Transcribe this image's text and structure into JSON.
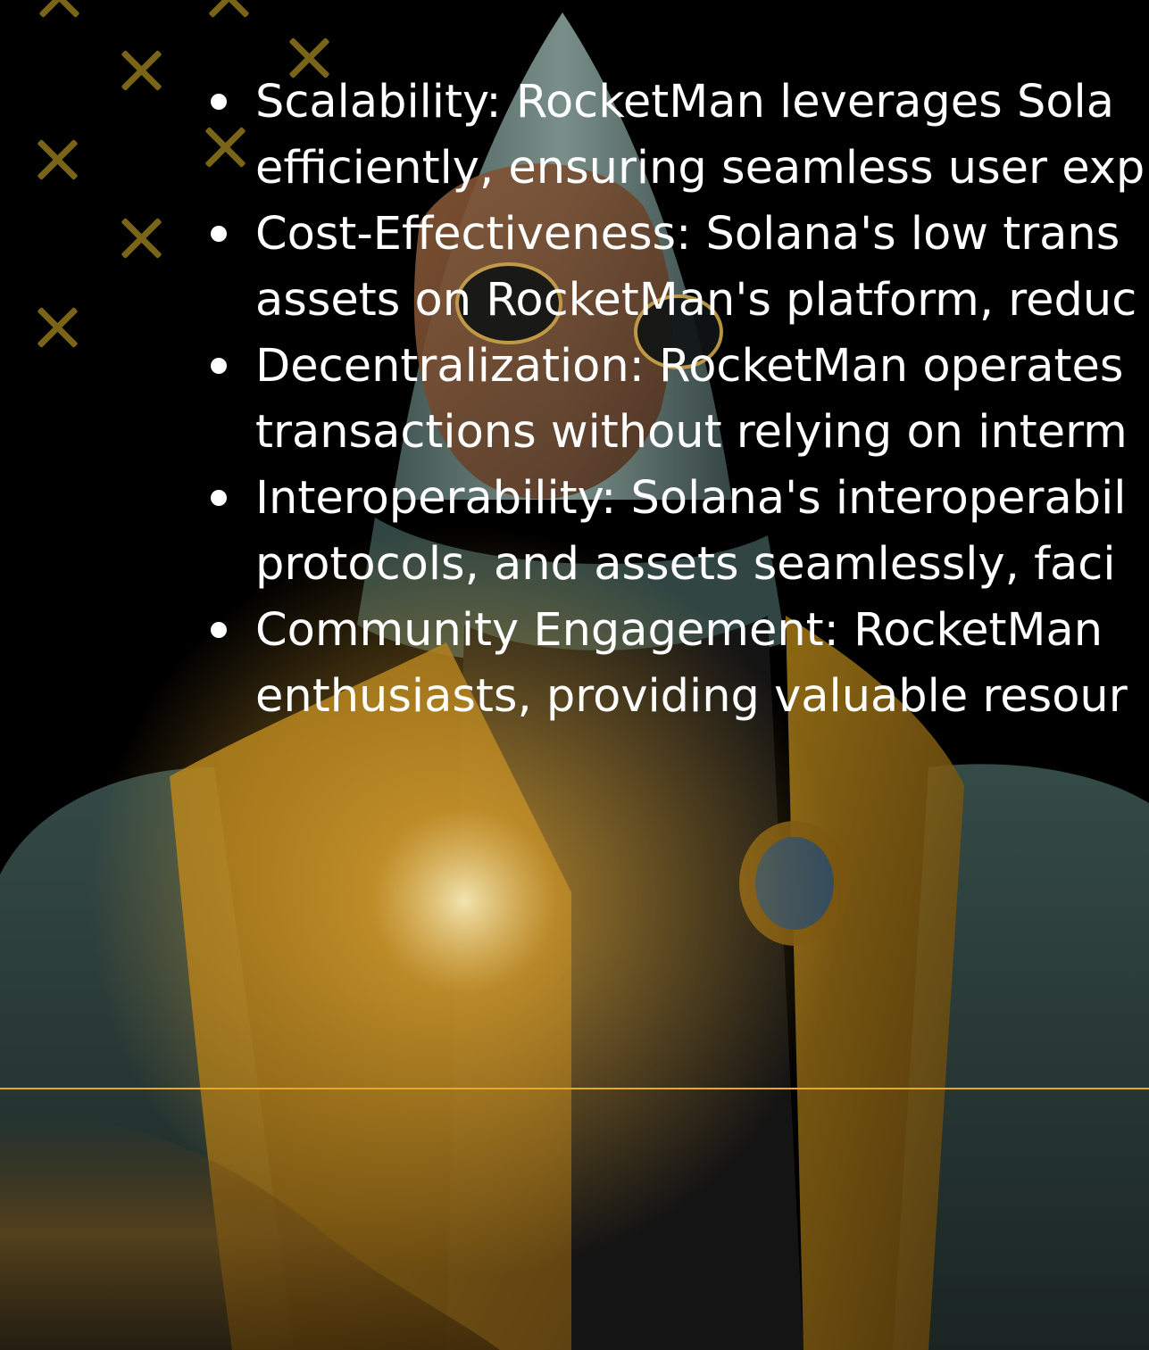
{
  "colors": {
    "background": "#000000",
    "accent": "#e8a91e",
    "decor_x": "#7a6418",
    "text": "#ffffff"
  },
  "hero": {
    "icon": "rocketman-illustration"
  },
  "features": [
    {
      "line1": "Scalability: RocketMan leverages Sola",
      "line2": "efficiently, ensuring seamless user exp"
    },
    {
      "line1": "Cost-Effectiveness: Solana's low trans",
      "line2": "assets on RocketMan's platform, reduc"
    },
    {
      "line1": "Decentralization: RocketMan operates",
      "line2": "transactions without relying on interm"
    },
    {
      "line1": "Interoperability: Solana's interoperabil",
      "line2": "protocols, and assets seamlessly, faci"
    },
    {
      "line1": "Community Engagement: RocketMan",
      "line2": "enthusiasts, providing valuable resour"
    }
  ]
}
